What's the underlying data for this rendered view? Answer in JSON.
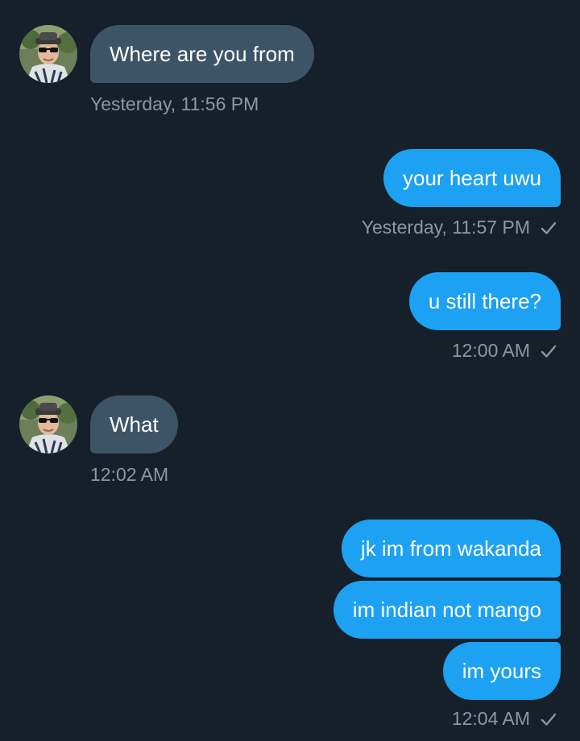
{
  "colors": {
    "background": "#15202b",
    "incoming_bubble": "#3d5466",
    "outgoing_bubble": "#1da1f2",
    "meta_text": "#8899a6"
  },
  "messages": [
    {
      "direction": "incoming",
      "text": "Where are you from",
      "time": "Yesterday, 11:56 PM"
    },
    {
      "direction": "outgoing",
      "text": "your heart uwu",
      "time": "Yesterday, 11:57 PM",
      "status_icon": "check-icon"
    },
    {
      "direction": "outgoing",
      "text": "u still there?",
      "time": "12:00 AM",
      "status_icon": "check-icon"
    },
    {
      "direction": "incoming",
      "text": "What",
      "time": "12:02 AM"
    },
    {
      "direction": "outgoing",
      "text": "jk im from wakanda"
    },
    {
      "direction": "outgoing",
      "text": "im indian not mango"
    },
    {
      "direction": "outgoing",
      "text": "im yours",
      "time": "12:04 AM",
      "status_icon": "check-icon"
    }
  ]
}
